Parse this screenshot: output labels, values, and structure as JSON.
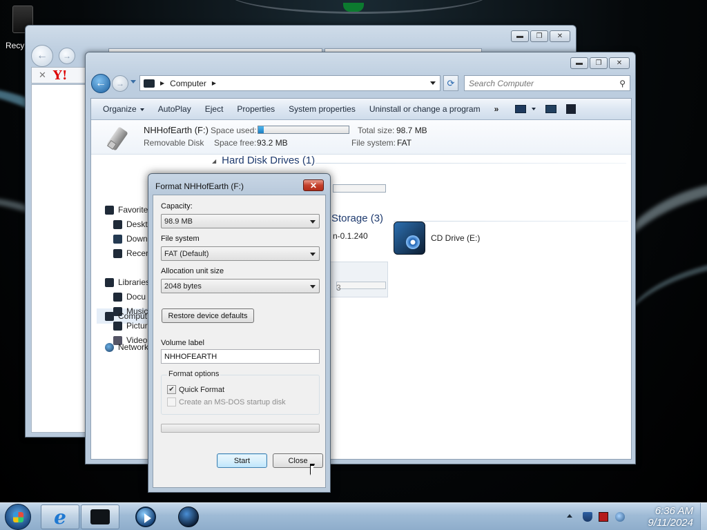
{
  "desktop": {
    "recycle_label": "Recy"
  },
  "explorer": {
    "address": "Computer",
    "search_placeholder": "Search Computer",
    "commands": [
      "Organize",
      "AutoPlay",
      "Eject",
      "Properties",
      "System properties",
      "Uninstall or change a program"
    ],
    "more_label": "»",
    "details": {
      "name": "NHHofEarth (F:)",
      "type": "Removable Disk",
      "space_used_label": "Space used:",
      "space_free_label": "Space free:",
      "space_free_value": "93.2 MB",
      "total_size_label": "Total size:",
      "total_size_value": "98.7 MB",
      "file_system_label": "File system:",
      "file_system_value": "FAT",
      "space_used_fraction": 0.06
    },
    "nav": {
      "favorites": "Favorites",
      "desktop": "Deskto",
      "downloads": "Down",
      "recent": "Recen",
      "libraries": "Libraries",
      "documents": "Docu",
      "music": "Music",
      "pictures": "Pictur",
      "videos": "Videos",
      "computer": "Comput",
      "network": "Network"
    },
    "content": {
      "hdd_group": "Hard Disk Drives (1)",
      "storage_group": "Storage (3)",
      "partial_item": "n-0.1.240",
      "cd_drive": "CD Drive (E:)",
      "partial_b": "3"
    }
  },
  "dialog": {
    "title": "Format NHHofEarth (F:)",
    "capacity_label": "Capacity:",
    "capacity_value": "98.9 MB",
    "fs_label": "File system",
    "fs_value": "FAT (Default)",
    "alloc_label": "Allocation unit size",
    "alloc_value": "2048 bytes",
    "restore_btn": "Restore device defaults",
    "volume_label": "Volume label",
    "volume_value": "NHHOFEARTH",
    "options_title": "Format options",
    "quick_format": "Quick Format",
    "msdos": "Create an MS-DOS startup disk",
    "start_btn": "Start",
    "close_btn": "Close",
    "progress": 0
  },
  "taskbar": {
    "time": "6:36 AM",
    "date": "9/11/2024"
  }
}
